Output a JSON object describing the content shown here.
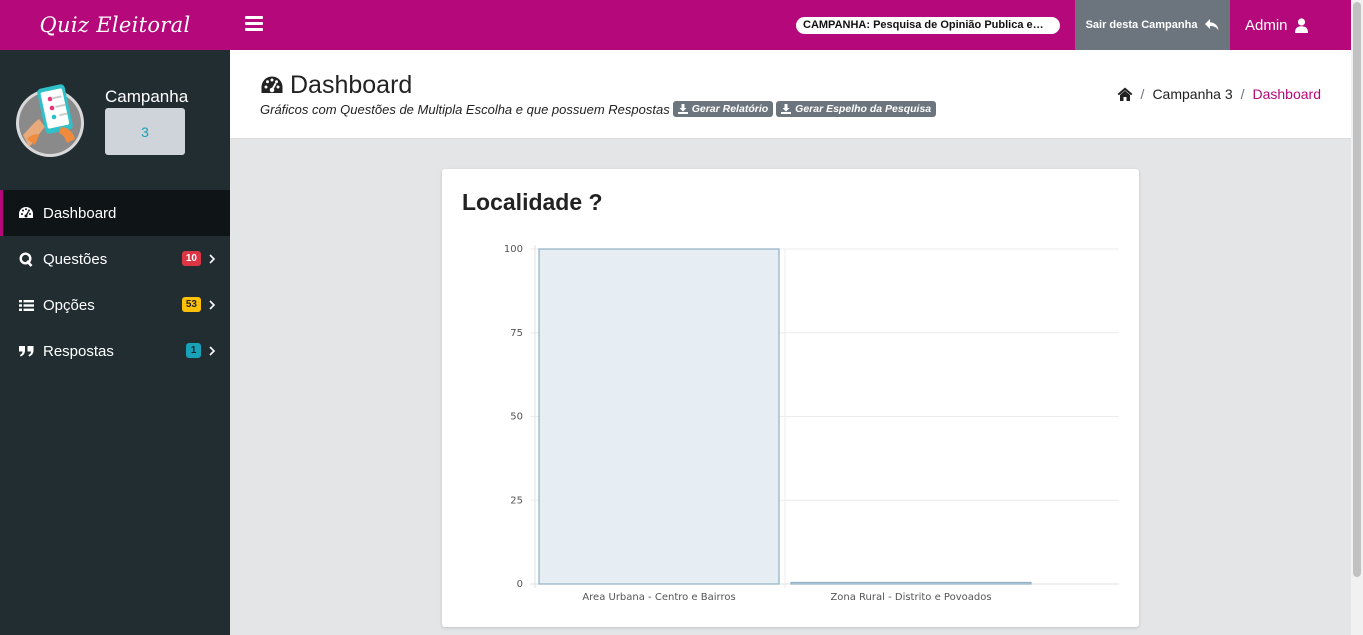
{
  "topbar": {
    "brand": "Quiz Eleitoral",
    "campaign_pill": "CAMPANHA: Pesquisa de Opinião Publica em Iapu...",
    "exit_label": "Sair desta Campanha",
    "admin_label": "Admin",
    "bg_color": "#b5087a"
  },
  "sidebar": {
    "campaign_label": "Campanha",
    "campaign_number": "3",
    "items": [
      {
        "label": "Dashboard",
        "icon": "dashboard-icon",
        "active": true
      },
      {
        "label": "Questões",
        "icon": "q-icon",
        "badge": "10",
        "badge_color": "#dc3545"
      },
      {
        "label": "Opções",
        "icon": "list-icon",
        "badge": "53",
        "badge_color": "#ffc107"
      },
      {
        "label": "Respostas",
        "icon": "quote-icon",
        "badge": "1",
        "badge_color": "#17a2b8"
      }
    ]
  },
  "header": {
    "title": "Dashboard",
    "subtitle": "Gráficos com Questões de Multipla Escolha e que possuem Respostas",
    "report_btn": "Gerar Relatório",
    "mirror_btn": "Gerar Espelho da Pesquisa",
    "breadcrumb": {
      "campaign": "Campanha 3",
      "current": "Dashboard"
    }
  },
  "card": {
    "title": "Localidade ?"
  },
  "chart_data": {
    "type": "bar",
    "title": "Localidade ?",
    "categories": [
      "Area Urbana - Centro e Bairros",
      "Zona Rural - Distrito e Povoados"
    ],
    "values": [
      100,
      0
    ],
    "ylim": [
      0,
      100
    ],
    "yticks": [
      0,
      25,
      50,
      75,
      100
    ],
    "xlabel": "",
    "ylabel": "",
    "grid": true,
    "bar_fill": "#e6eef3",
    "bar_stroke": "#8fb0c6"
  }
}
